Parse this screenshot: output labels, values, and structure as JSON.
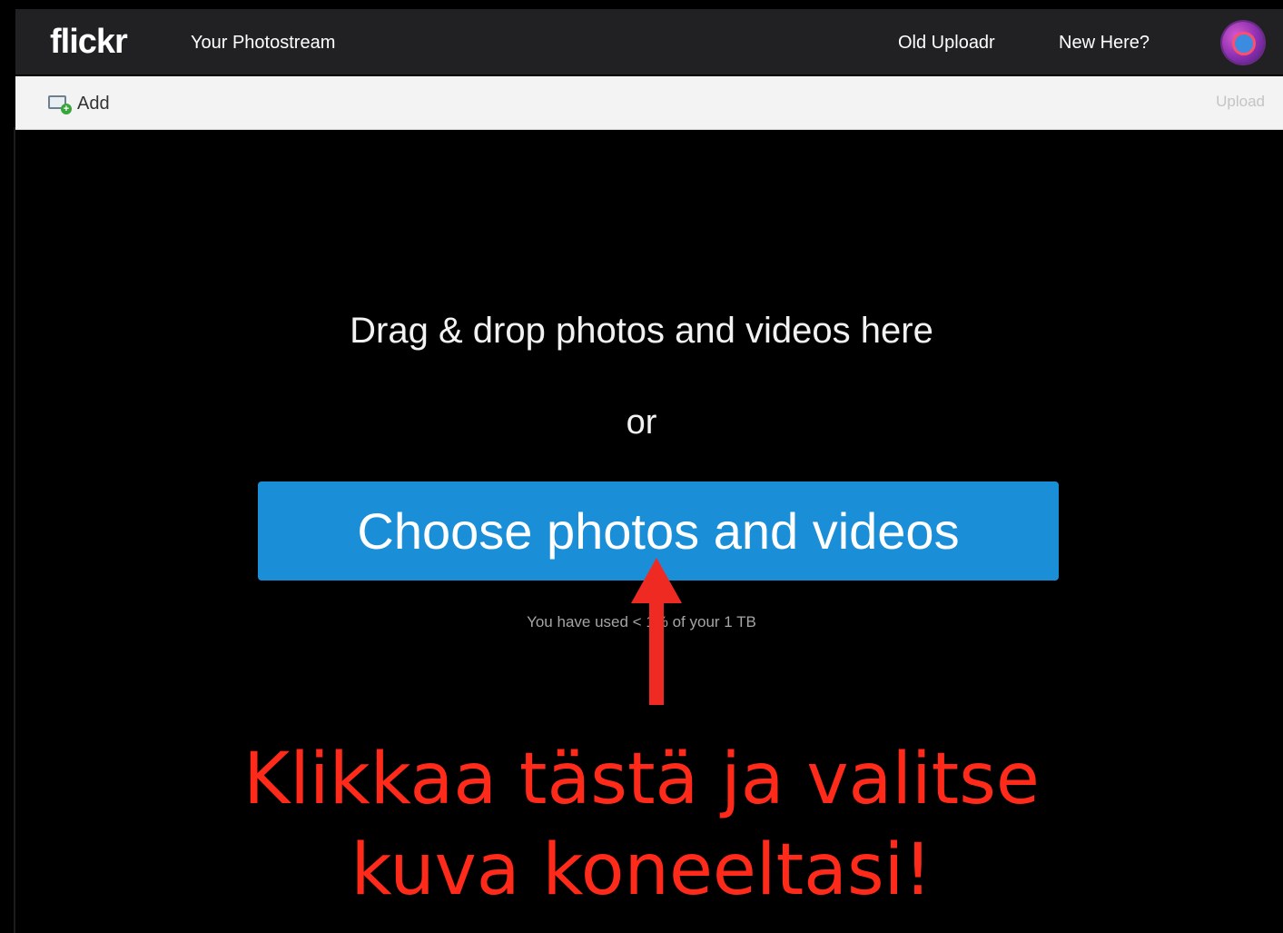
{
  "header": {
    "logo_text": "flickr",
    "nav": {
      "photostream": "Your Photostream",
      "old_uploadr": "Old Uploadr",
      "new_here": "New Here?"
    }
  },
  "toolbar": {
    "add_label": "Add",
    "upload_label": "Upload"
  },
  "main": {
    "drop_text": "Drag & drop photos and videos here",
    "or_text": "or",
    "choose_button": "Choose photos and videos",
    "usage_text": "You have used < 1% of your 1 TB"
  },
  "annotation": {
    "line1": "Klikkaa tästä ja valitse",
    "line2": "kuva koneeltasi!",
    "color": "#ff2a1a"
  },
  "colors": {
    "topbar": "#212124",
    "button_blue": "#1a8fd8",
    "toolbar": "#f3f3f3"
  },
  "icons": {
    "add": "add-photo-icon",
    "avatar": "user-avatar",
    "arrow": "arrow-up-icon"
  }
}
